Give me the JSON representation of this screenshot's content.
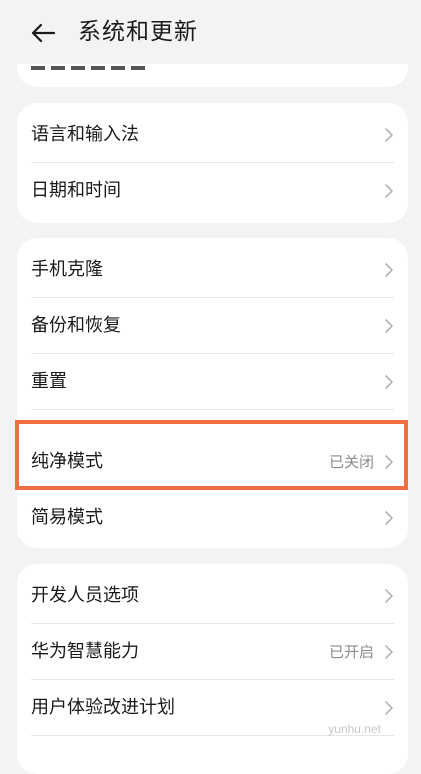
{
  "header": {
    "title": "系统和更新"
  },
  "groups": [
    {
      "items": [
        {
          "label": "语言和输入法",
          "value": ""
        },
        {
          "label": "日期和时间",
          "value": ""
        }
      ]
    },
    {
      "items": [
        {
          "label": "手机克隆",
          "value": ""
        },
        {
          "label": "备份和恢复",
          "value": ""
        },
        {
          "label": "重置",
          "value": ""
        },
        {
          "label": "纯净模式",
          "value": "已关闭"
        },
        {
          "label": "简易模式",
          "value": ""
        }
      ]
    },
    {
      "items": [
        {
          "label": "开发人员选项",
          "value": ""
        },
        {
          "label": "华为智慧能力",
          "value": "已开启"
        },
        {
          "label": "用户体验改进计划",
          "value": ""
        }
      ]
    }
  ],
  "highlight_color": "#ee7040",
  "watermark": "yunhu.net"
}
